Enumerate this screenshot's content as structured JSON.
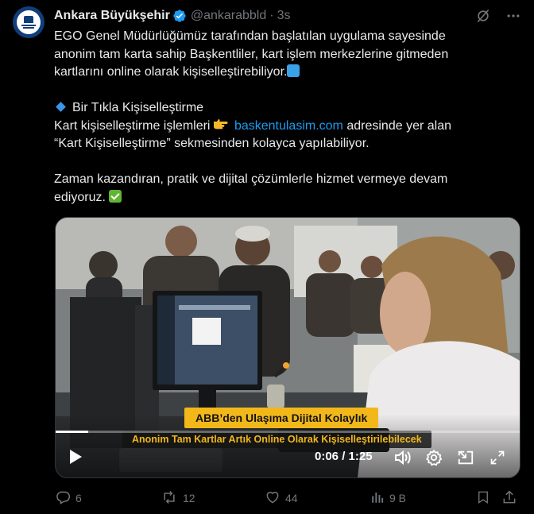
{
  "author": {
    "name": "Ankara Büyükşehir",
    "handle": "@ankarabbld",
    "separator": "·",
    "time": "3s"
  },
  "tweet": {
    "line1": "EGO Genel Müdürlüğümüz tarafından başlatılan uygulama sayesinde",
    "line2": "anonim tam karta sahip Başkentliler, kart işlem merkezlerine gitmeden",
    "line3": "kartlarını online olarak kişiselleştirebiliyor.",
    "heading": "Bir Tıkla Kişiselleştirme",
    "line4_pre": "Kart kişiselleştirme işlemleri",
    "link": "baskentulasim.com",
    "line4_post": "adresinde yer alan",
    "line5": "“Kart Kişiselleştirme” sekmesinden kolayca yapılabiliyor.",
    "line6": "Zaman kazandıran, pratik ve dijital çözümlerle hizmet vermeye devam",
    "line7": "ediyoruz."
  },
  "video": {
    "caption_title": "ABB’den Ulaşıma Dijital Kolaylık",
    "caption_sub": "Anonim Tam Kartlar Artık Online Olarak Kişiselleştirilebilecek",
    "time": "0:06 / 1:25",
    "progress": 0.07
  },
  "actions": {
    "replies": "6",
    "reposts": "12",
    "likes": "44",
    "views": "9 B"
  },
  "icons": {
    "verified": "verified-badge-icon",
    "grok": "grok-icon",
    "more": "more-icon",
    "play": "play-icon",
    "volume": "volume-icon",
    "settings": "settings-icon",
    "pip": "picture-in-picture-icon",
    "fullscreen": "fullscreen-icon"
  },
  "colors": {
    "accent": "#1d9bf0",
    "caption_bg": "#f2b81a"
  }
}
